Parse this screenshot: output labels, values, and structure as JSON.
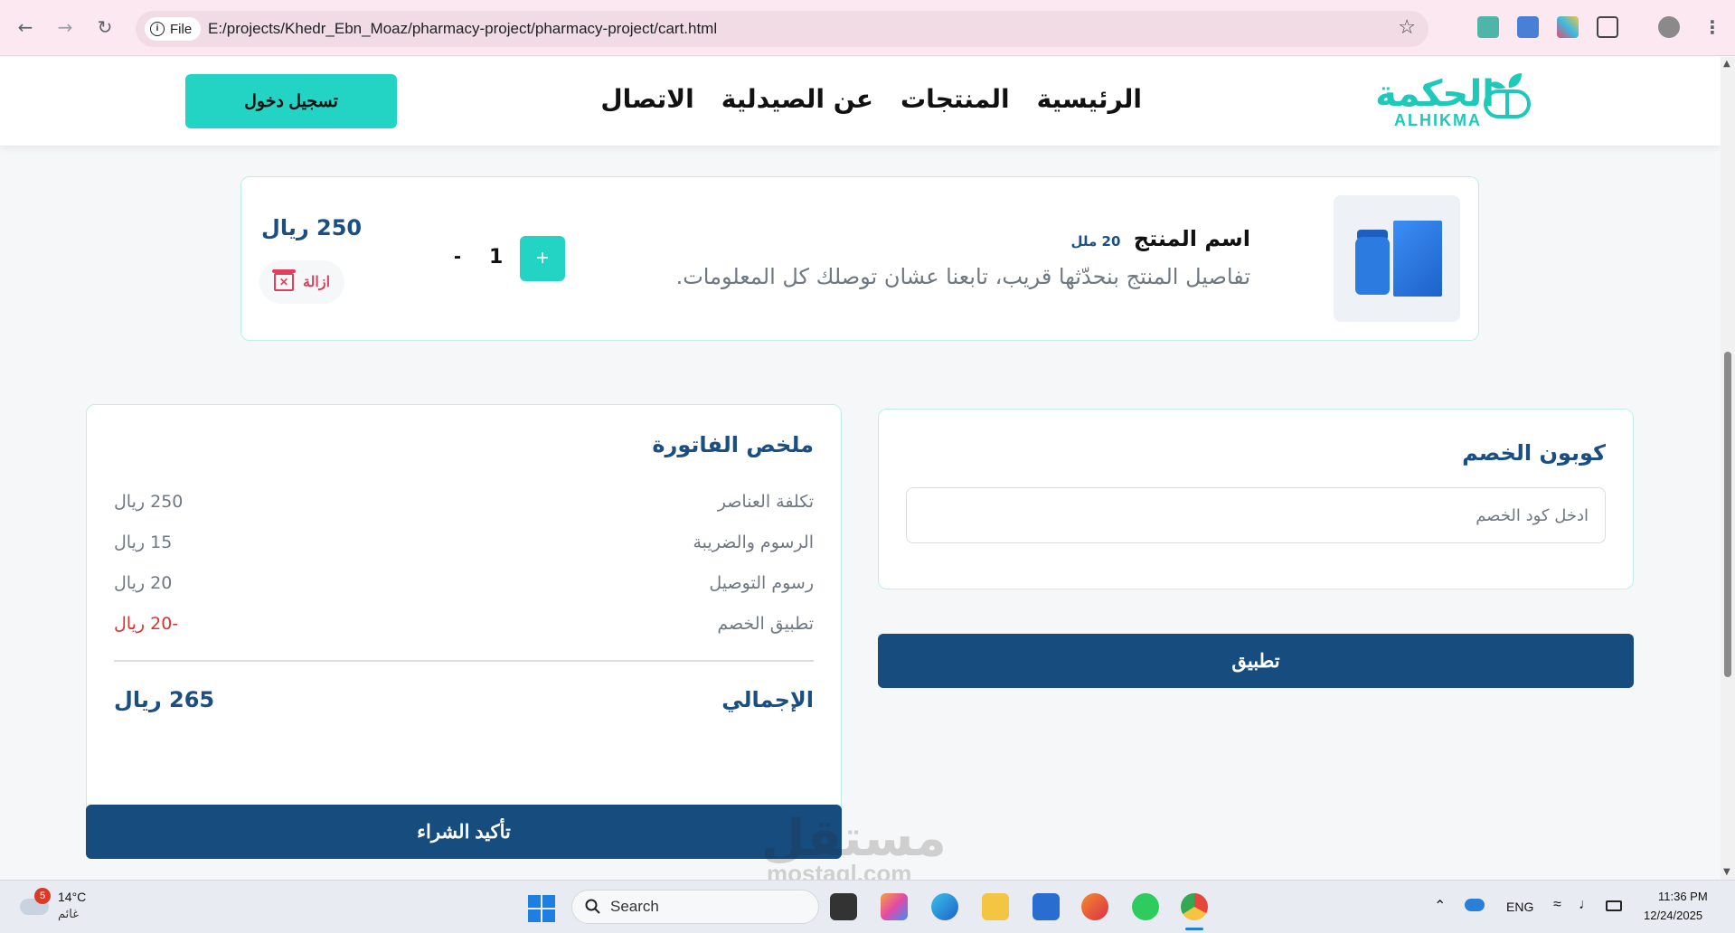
{
  "browser": {
    "scheme_label": "File",
    "url": "E:/projects/Khedr_Ebn_Moaz/pharmacy-project/pharmacy-project/cart.html"
  },
  "header": {
    "logo_ar": "الحكمة",
    "logo_en": "ALHIKMA",
    "nav": [
      "الرئيسية",
      "المنتجات",
      "عن الصيدلية",
      "الاتصال"
    ],
    "login_label": "تسجيل دخول"
  },
  "cart_item": {
    "name": "اسم المنتج",
    "size": "20 ملل",
    "description": "تفاصيل المنتج بنحدّثها قريب، تابعنا عشان توصلك كل المعلومات.",
    "quantity": "1",
    "plus_label": "+",
    "minus_label": "-",
    "price": "250 ريال",
    "remove_label": "ازالة"
  },
  "invoice": {
    "title": "ملخص الفاتورة",
    "rows": [
      {
        "label": "تكلفة العناصر",
        "value": "250 ريال"
      },
      {
        "label": "الرسوم والضريبة",
        "value": "15 ريال"
      },
      {
        "label": "رسوم التوصيل",
        "value": "20 ريال"
      },
      {
        "label": "تطبيق الخصم",
        "value": "-20 ريال"
      }
    ],
    "total_label": "الإجمالي",
    "total_value": "265 ريال"
  },
  "coupon": {
    "title": "كوبون الخصم",
    "placeholder": "ادخل كود الخصم",
    "apply_label": "تطبيق"
  },
  "confirm_label": "تأكيد الشراء",
  "watermark": {
    "ar": "مستقل",
    "en": "mostaql.com"
  },
  "taskbar": {
    "weather_badge": "5",
    "temperature": "14°C",
    "weather_desc": "غائم",
    "search_label": "Search",
    "language": "ENG",
    "time": "11:36 PM",
    "date": "12/24/2025"
  },
  "colors": {
    "brand_teal": "#23d4c5",
    "brand_navy": "#174c7e",
    "danger": "#e04060"
  }
}
